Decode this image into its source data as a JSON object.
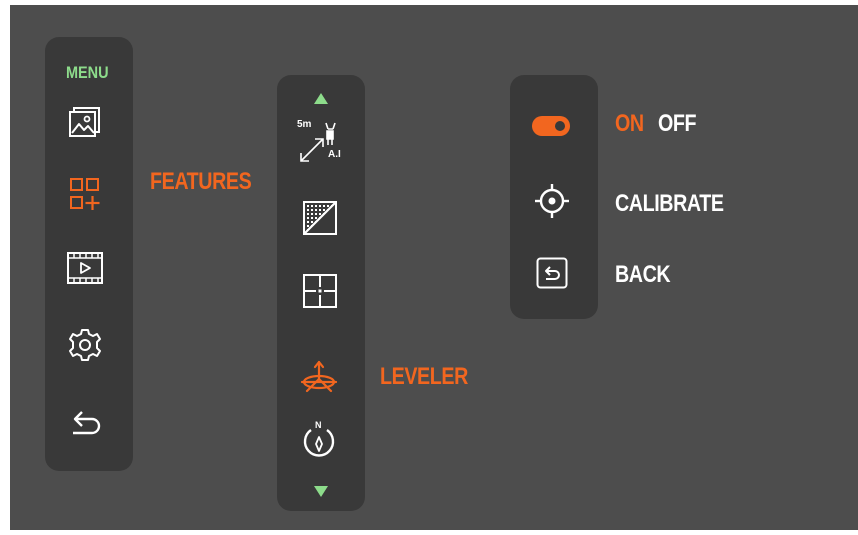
{
  "menu": {
    "title": "MENU",
    "items": [
      {
        "icon": "gallery-icon"
      },
      {
        "icon": "features-icon",
        "active": true
      },
      {
        "icon": "video-playback-icon"
      },
      {
        "icon": "gear-icon"
      },
      {
        "icon": "back-arrow-icon"
      }
    ]
  },
  "features": {
    "label": "FEATURES",
    "items": [
      {
        "icon": "ai-rangefinder-icon",
        "text_top": "5m",
        "text_bottom": "A.I"
      },
      {
        "icon": "gradient-icon"
      },
      {
        "icon": "crosshair-grid-icon"
      },
      {
        "icon": "leveler-icon",
        "active": true
      },
      {
        "icon": "compass-icon",
        "text": "N"
      }
    ]
  },
  "leveler": {
    "label": "LEVELER",
    "toggle": {
      "on_label": "ON",
      "off_label": "OFF",
      "state": "on"
    },
    "calibrate_label": "CALIBRATE",
    "back_label": "BACK"
  },
  "colors": {
    "background": "#4d4d4d",
    "panel": "#393939",
    "accent": "#f2661f",
    "highlight": "#8ddc8b",
    "text": "#ffffff"
  }
}
